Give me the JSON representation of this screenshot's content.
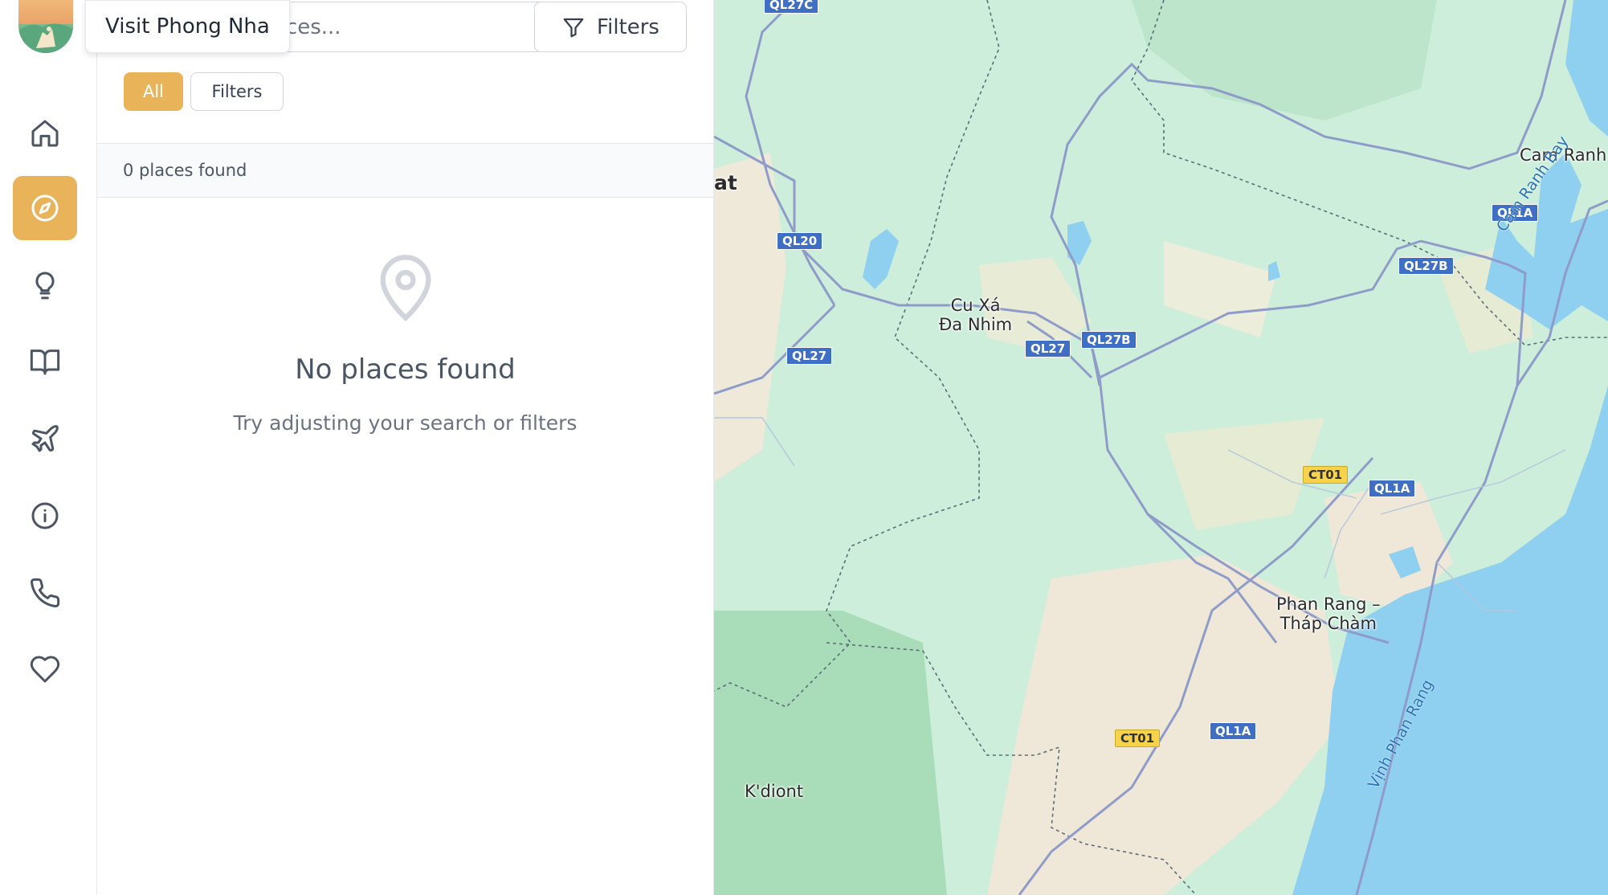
{
  "brand": {
    "tooltip": "Visit Phong Nha"
  },
  "nav": {
    "items": [
      {
        "name": "home",
        "icon": "home-icon",
        "active": false
      },
      {
        "name": "explore",
        "icon": "compass-icon",
        "active": true
      },
      {
        "name": "tips",
        "icon": "lightbulb-icon",
        "active": false
      },
      {
        "name": "guide",
        "icon": "book-icon",
        "active": false
      },
      {
        "name": "travel",
        "icon": "plane-icon",
        "active": false
      },
      {
        "name": "info",
        "icon": "info-icon",
        "active": false
      },
      {
        "name": "contact",
        "icon": "phone-icon",
        "active": false
      },
      {
        "name": "favorites",
        "icon": "heart-icon",
        "active": false
      }
    ],
    "accent_color": "#e9b35a"
  },
  "search": {
    "placeholder_visible": "aces..."
  },
  "toolbar": {
    "filters_label": "Filters"
  },
  "chips": {
    "all_label": "All",
    "filters_label": "Filters"
  },
  "results": {
    "count_text": "0 places found",
    "empty_title": "No places found",
    "empty_subtitle": "Try adjusting your search or filters"
  },
  "map": {
    "road_labels": [
      "QL27C",
      "QL20",
      "QL27",
      "QL27",
      "QL27B",
      "QL27B",
      "QL1A",
      "QL1A",
      "QL1A",
      "CT01",
      "CT01"
    ],
    "places": {
      "cu_xa": "Cu Xá\nĐa Nhim",
      "phan_rang": "Phan Rang –\nTháp Chàm",
      "cam_ranh": "Cam Ranh",
      "kdiont": "K'diont",
      "at": "at"
    },
    "water": {
      "cam_ranh_bay": "Cam Ranh Bay",
      "vinh_phan_rang": "Vịnh Phan Rang"
    }
  }
}
